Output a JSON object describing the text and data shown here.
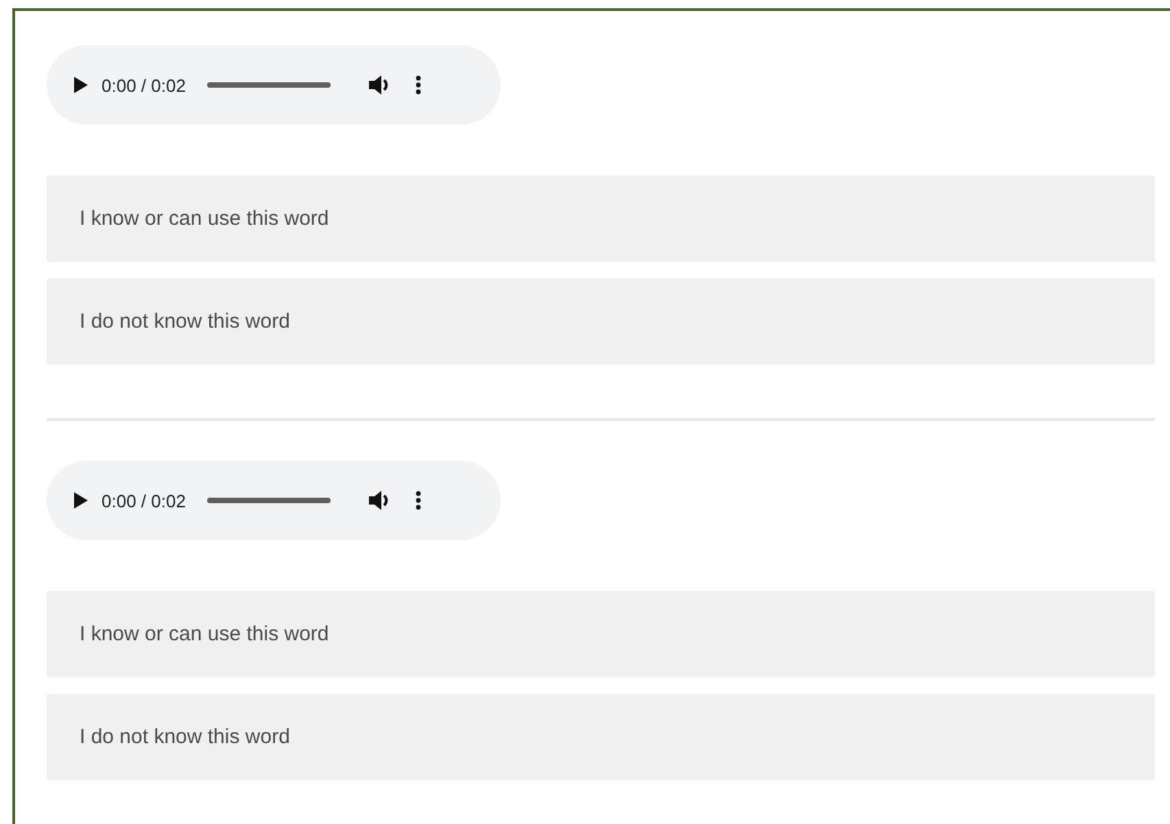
{
  "questions": [
    {
      "player": {
        "time": "0:00 / 0:02"
      },
      "options": [
        {
          "label": "I know or can use this word"
        },
        {
          "label": "I do not know this word"
        }
      ]
    },
    {
      "player": {
        "time": "0:00 / 0:02"
      },
      "options": [
        {
          "label": "I know or can use this word"
        },
        {
          "label": "I do not know this word"
        }
      ]
    }
  ]
}
